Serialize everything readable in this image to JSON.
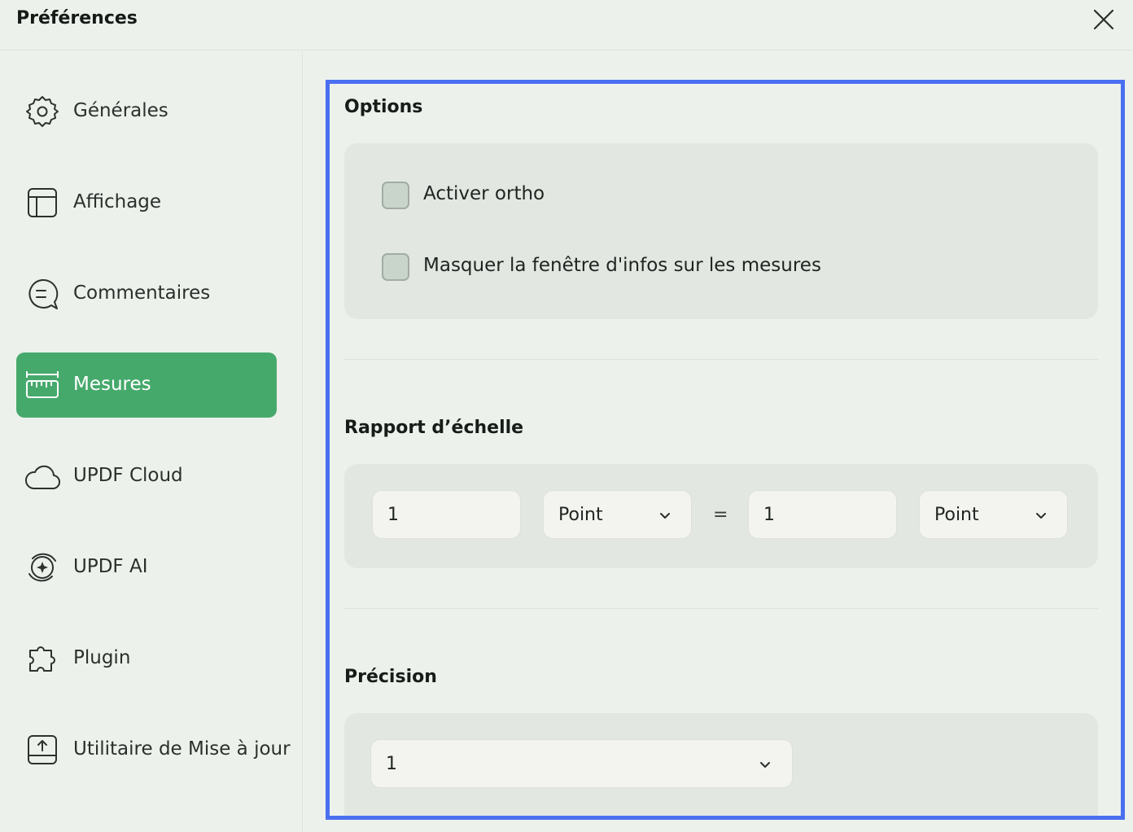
{
  "window": {
    "title": "Préférences"
  },
  "sidebar": {
    "items": [
      {
        "label": "Générales",
        "icon": "gear-icon",
        "active": false
      },
      {
        "label": "Affichage",
        "icon": "layout-icon",
        "active": false
      },
      {
        "label": "Commentaires",
        "icon": "comment-icon",
        "active": false
      },
      {
        "label": "Mesures",
        "icon": "ruler-icon",
        "active": true
      },
      {
        "label": "UPDF Cloud",
        "icon": "cloud-icon",
        "active": false
      },
      {
        "label": "UPDF AI",
        "icon": "ai-icon",
        "active": false
      },
      {
        "label": "Plugin",
        "icon": "puzzle-icon",
        "active": false
      },
      {
        "label": "Utilitaire de Mise à jour",
        "icon": "update-icon",
        "active": false
      }
    ]
  },
  "options": {
    "title": "Options",
    "checkboxes": [
      {
        "label": "Activer ortho",
        "checked": false
      },
      {
        "label": "Masquer la fenêtre d'infos sur les mesures",
        "checked": false
      }
    ]
  },
  "scale": {
    "title": "Rapport d’échelle",
    "left_value": "1",
    "left_unit": "Point",
    "equals": "=",
    "right_value": "1",
    "right_unit": "Point"
  },
  "precision": {
    "title": "Précision",
    "value": "1"
  },
  "colors": {
    "accent": "#46a96c",
    "focus_border": "#4a6ff0",
    "background": "#edf1ec",
    "panel": "#e3e7e2"
  }
}
